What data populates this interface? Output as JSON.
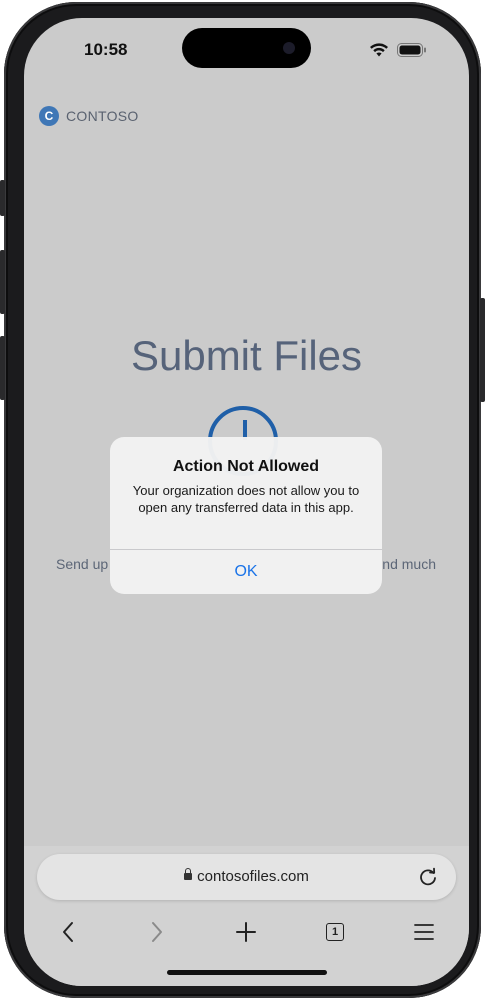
{
  "status_bar": {
    "time": "10:58"
  },
  "page": {
    "brand_logo_letter": "C",
    "brand_name": "CONTOSO",
    "title": "Submit Files",
    "description_left": "Send up",
    "description_right": "nd much"
  },
  "alert": {
    "title": "Action Not Allowed",
    "message": "Your organization does not allow you to open any transferred data in this app.",
    "ok_label": "OK"
  },
  "browser": {
    "url": "contosofiles.com",
    "tab_count": "1"
  },
  "colors": {
    "accent": "#1a73e8",
    "brand": "#3f77b6"
  },
  "icons": [
    "wifi-icon",
    "battery-icon",
    "lock-icon",
    "reload-icon",
    "back-icon",
    "forward-icon",
    "new-tab-icon",
    "tabs-icon",
    "menu-icon"
  ]
}
